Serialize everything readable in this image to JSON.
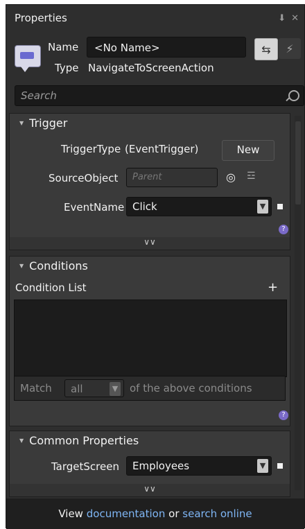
{
  "panel": {
    "title": "Properties",
    "pin_icon": "pin-icon",
    "close_icon": "close-icon"
  },
  "header": {
    "name_label": "Name",
    "name_value": "<No Name>",
    "type_label": "Type",
    "type_value": "NavigateToScreenAction",
    "object_icon": "object-icon",
    "properties_view_icon": "properties-view-icon",
    "events_view_icon": "events-view-icon"
  },
  "search": {
    "placeholder": "Search"
  },
  "trigger": {
    "title": "Trigger",
    "trigger_type_label": "TriggerType",
    "trigger_type_value": "(EventTrigger)",
    "new_button": "New",
    "source_object_label": "SourceObject",
    "source_object_value": "Parent",
    "event_name_label": "EventName",
    "event_name_value": "Click"
  },
  "conditions": {
    "title": "Conditions",
    "list_label": "Condition List",
    "match_label": "Match",
    "match_value": "all",
    "match_suffix": "of the above conditions"
  },
  "common": {
    "title": "Common Properties",
    "target_screen_label": "TargetScreen",
    "target_screen_value": "Employees"
  },
  "footer": {
    "prefix": "View",
    "documentation": "documentation",
    "or": "or",
    "search_online": "search online"
  },
  "colors": {
    "panel_bg": "#2e2e2e",
    "section_bg": "#3a3a3a",
    "input_bg": "#1a1a1a",
    "link": "#7fb6f5",
    "help_badge": "#7a6ac8"
  }
}
